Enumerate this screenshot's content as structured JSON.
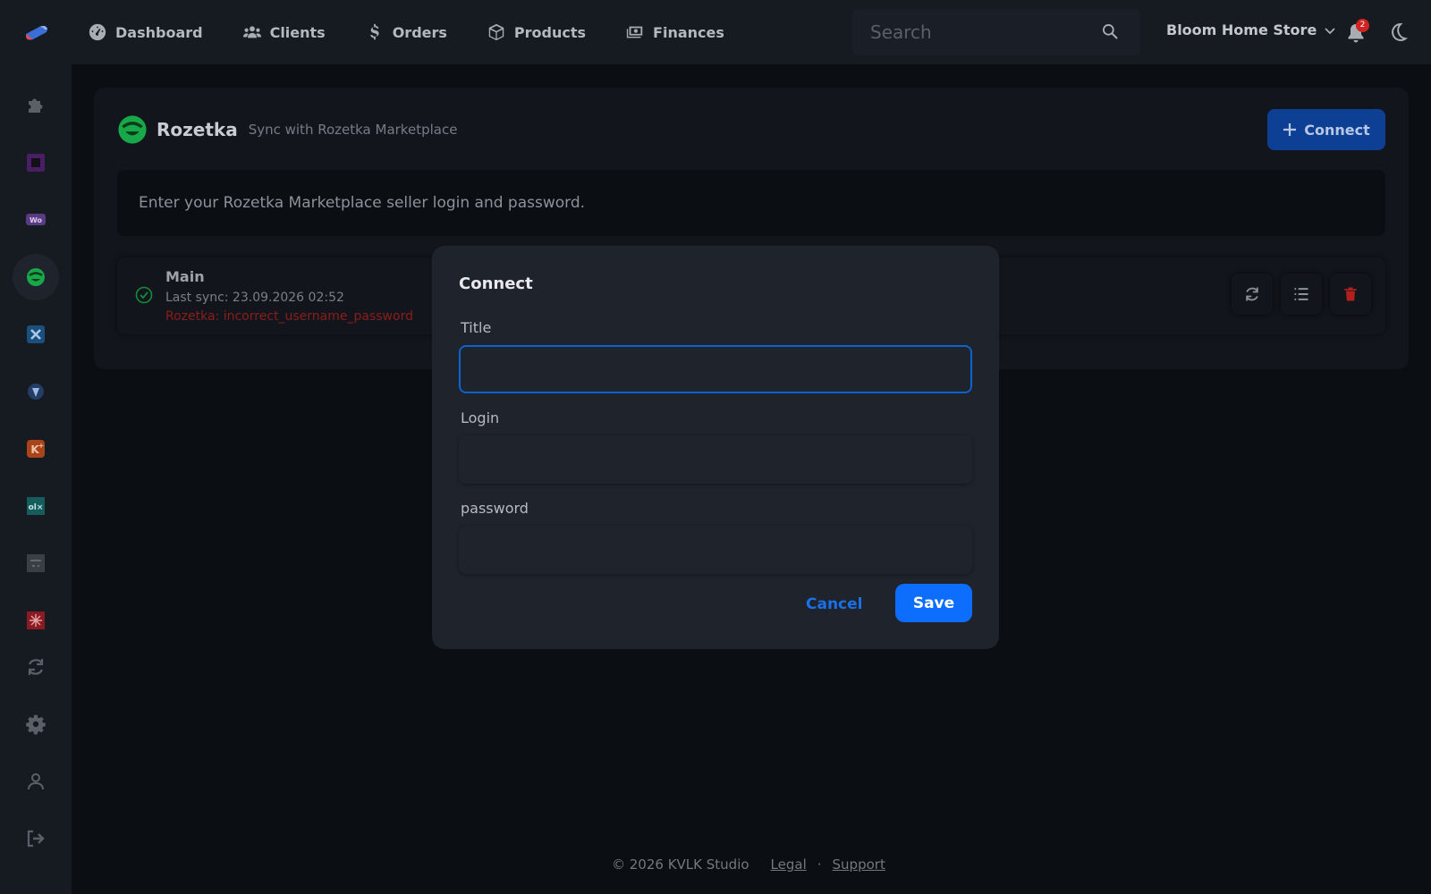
{
  "colors": {
    "accent": "#0d6efd",
    "brand_green": "#1aa34a",
    "error": "#8b1d1b",
    "delete_red": "#b3201c"
  },
  "nav": {
    "items": [
      {
        "label": "Dashboard",
        "icon": "speedometer-icon"
      },
      {
        "label": "Clients",
        "icon": "users-icon"
      },
      {
        "label": "Orders",
        "icon": "dollar-icon"
      },
      {
        "label": "Products",
        "icon": "box-icon"
      },
      {
        "label": "Finances",
        "icon": "money-icon"
      }
    ],
    "search_placeholder": "Search",
    "store_name": "Bloom Home Store",
    "notification_count": "2"
  },
  "sidebar": {
    "items": [
      {
        "icon": "puzzle-icon"
      },
      {
        "icon": "square-app-icon"
      },
      {
        "icon": "woo-icon"
      },
      {
        "icon": "rozetka-icon",
        "active": true
      },
      {
        "icon": "x-app-icon"
      },
      {
        "icon": "shield-app-icon"
      },
      {
        "icon": "kplus-icon"
      },
      {
        "icon": "olx-icon"
      },
      {
        "icon": "generic-app-icon"
      },
      {
        "icon": "red-app-icon"
      },
      {
        "icon": "sync-icon"
      },
      {
        "icon": "gear-icon"
      },
      {
        "icon": "user-icon"
      },
      {
        "icon": "logout-icon"
      }
    ]
  },
  "card": {
    "title": "Rozetka",
    "subtitle": "Sync with Rozetka Marketplace",
    "connect_label": "Connect",
    "info": "Enter your Rozetka Marketplace seller login and password.",
    "connection": {
      "name": "Main",
      "last_sync": "Last sync: 23.09.2026 02:52",
      "error": "Rozetka: incorrect_username_password"
    }
  },
  "modal": {
    "title": "Connect",
    "fields": {
      "title_label": "Title",
      "title_value": "",
      "login_label": "Login",
      "login_value": "",
      "password_label": "password",
      "password_value": ""
    },
    "cancel_label": "Cancel",
    "save_label": "Save"
  },
  "footer": {
    "copyright": "© 2026 KVLK Studio",
    "legal": "Legal",
    "separator": "·",
    "support": "Support"
  }
}
